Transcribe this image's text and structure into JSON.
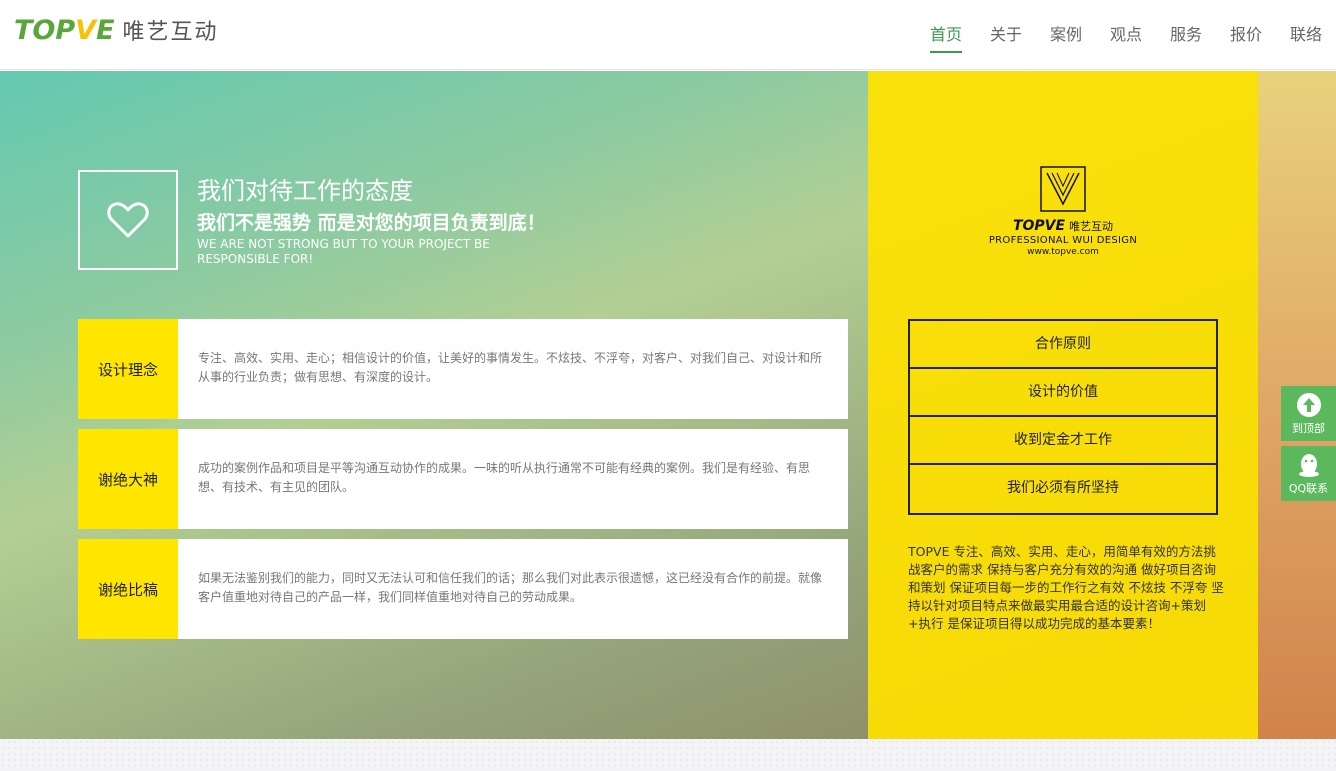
{
  "header": {
    "logo_text_a": "TOP",
    "logo_text_v": "V",
    "logo_text_b": "E",
    "logo_cn": "唯艺互动",
    "nav": [
      {
        "label": "首页",
        "active": true
      },
      {
        "label": "关于"
      },
      {
        "label": "案例"
      },
      {
        "label": "观点"
      },
      {
        "label": "服务"
      },
      {
        "label": "报价"
      },
      {
        "label": "联络"
      }
    ]
  },
  "hero": {
    "title": "我们对待工作的态度",
    "subtitle": "我们不是强势 而是对您的项目负责到底！",
    "english": "WE ARE NOT STRONG BUT TO YOUR PROJECT BE RESPONSIBLE FOR!",
    "cards": [
      {
        "label": "设计理念",
        "text": "专注、高效、实用、走心；相信设计的价值，让美好的事情发生。不炫技、不浮夸，对客户、对我们自己、对设计和所从事的行业负责；做有思想、有深度的设计。"
      },
      {
        "label": "谢绝大神",
        "text": "成功的案例作品和项目是平等沟通互动协作的成果。一味的听从执行通常不可能有经典的案例。我们是有经验、有思想、有技术、有主见的团队。"
      },
      {
        "label": "谢绝比稿",
        "text": "如果无法鉴别我们的能力，同时又无法认可和信任我们的话；那么我们对此表示很遗憾，这已经没有合作的前提。就像客户值重地对待自己的产品一样，我们同样值重地对待自己的劳动成果。"
      }
    ]
  },
  "panel": {
    "brand_name": "TOPVE",
    "brand_cn": "唯艺互动",
    "brand_sub": "PROFESSIONAL WUI DESIGN",
    "brand_url": "www.topve.com",
    "principles": [
      "合作原则",
      "设计的价值",
      "收到定金才工作",
      "我们必须有所坚持"
    ],
    "description": "TOPVE 专注、高效、实用、走心，用简单有效的方法挑战客户的需求 保持与客户充分有效的沟通 做好项目咨询和策划 保证项目每一步的工作行之有效 不炫技 不浮夸 坚持以针对项目特点来做最实用最合适的设计咨询+策划+执行 是保证项目得以成功完成的基本要素！"
  },
  "side": {
    "top_label": "到顶部",
    "qq_label": "QQ联系"
  },
  "colors": {
    "accent_green": "#3a9a52",
    "card_yellow": "#ffe600",
    "float_green": "#5cb85c"
  }
}
